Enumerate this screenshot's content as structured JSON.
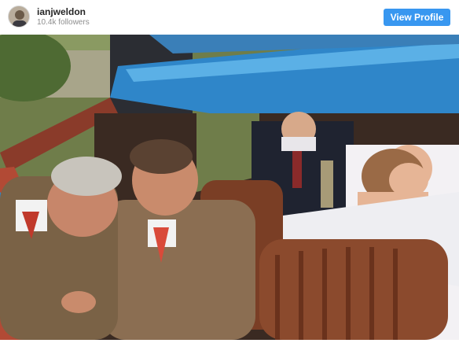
{
  "post": {
    "username": "ianjweldon",
    "followers": "10.4k followers",
    "view_profile_label": "View Profile"
  },
  "icons": {
    "avatar": "profile-avatar"
  },
  "colors": {
    "button": "#3897f0",
    "username": "#262626",
    "secondary_text": "#8e8e8e"
  }
}
